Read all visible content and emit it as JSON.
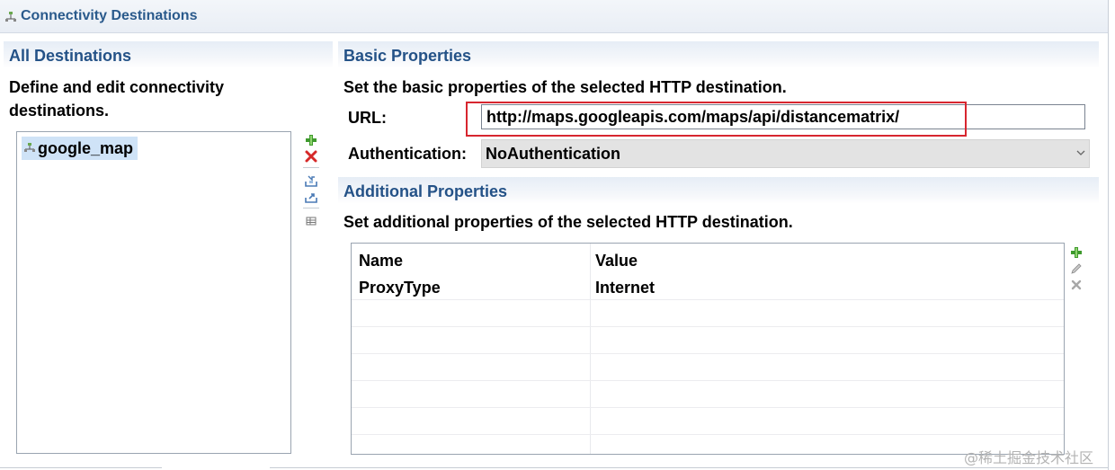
{
  "window": {
    "title": "Connectivity Destinations",
    "icon": "destination-node-icon"
  },
  "left_panel": {
    "title": "All Destinations",
    "description": "Define and edit connectivity destinations.",
    "destinations": [
      {
        "name": "google_map",
        "selected": true
      }
    ],
    "toolbar": [
      "add-icon",
      "delete-icon",
      "import-icon",
      "export-icon",
      "details-icon"
    ]
  },
  "basic": {
    "title": "Basic Properties",
    "description": "Set the basic properties of the selected HTTP destination.",
    "url_label": "URL:",
    "url_value": "http://maps.googleapis.com/maps/api/distancematrix/",
    "auth_label": "Authentication:",
    "auth_value": "NoAuthentication"
  },
  "additional": {
    "title": "Additional Properties",
    "description": "Set additional properties of the selected HTTP destination.",
    "columns": {
      "name": "Name",
      "value": "Value"
    },
    "rows": [
      {
        "name": "ProxyType",
        "value": "Internet"
      }
    ],
    "toolbar": [
      "add-icon",
      "edit-icon",
      "remove-icon"
    ]
  },
  "colors": {
    "section_title": "#245287",
    "selection": "#cfe3f7",
    "highlight_border": "#d7262f",
    "add_green": "#3f9a2e",
    "delete_red": "#d62828"
  },
  "watermark": "@稀土掘金技术社区"
}
